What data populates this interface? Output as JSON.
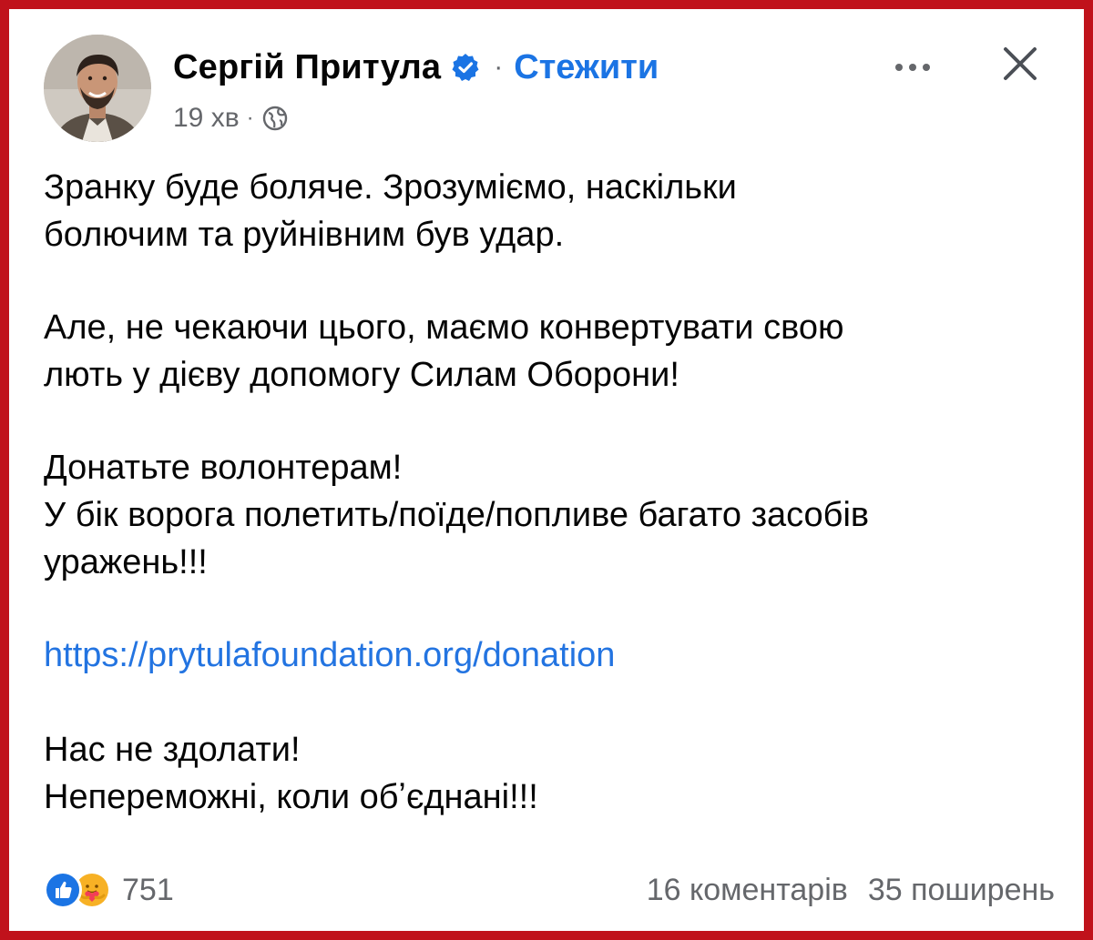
{
  "post": {
    "author": "Сергій Притула",
    "follow_label": "Стежити",
    "separator": "·",
    "time": "19 хв",
    "meta_separator": "·",
    "paragraphs": [
      [
        "Зранку буде боляче. Зрозуміємо, наскільки",
        "болючим та руйнівним був удар."
      ],
      [
        "Але, не чекаючи цього, маємо конвертувати свою",
        "лють у дієву допомогу Силам Оборони!"
      ],
      [
        "Донатьте волонтерам!",
        "У бік ворога полетить/поїде/попливе багато засобів",
        "уражень!!!"
      ]
    ],
    "link": "https://prytulafoundation.org/donation",
    "closing": [
      "Нас не здолати!",
      "Непереможні, коли обʼєднані!!!"
    ]
  },
  "footer": {
    "reactions_count": "751",
    "comments": "16 коментарів",
    "shares": "35 поширень"
  },
  "icons": {
    "verified": "verified-badge-icon",
    "globe": "globe-icon",
    "more": "more-dots-icon",
    "close": "close-icon",
    "like": "like-reaction-icon",
    "care": "care-reaction-icon"
  },
  "colors": {
    "frame_border": "#c0121b",
    "link_blue": "#1b74e4",
    "secondary_text": "#65676b",
    "primary_text": "#050505"
  }
}
